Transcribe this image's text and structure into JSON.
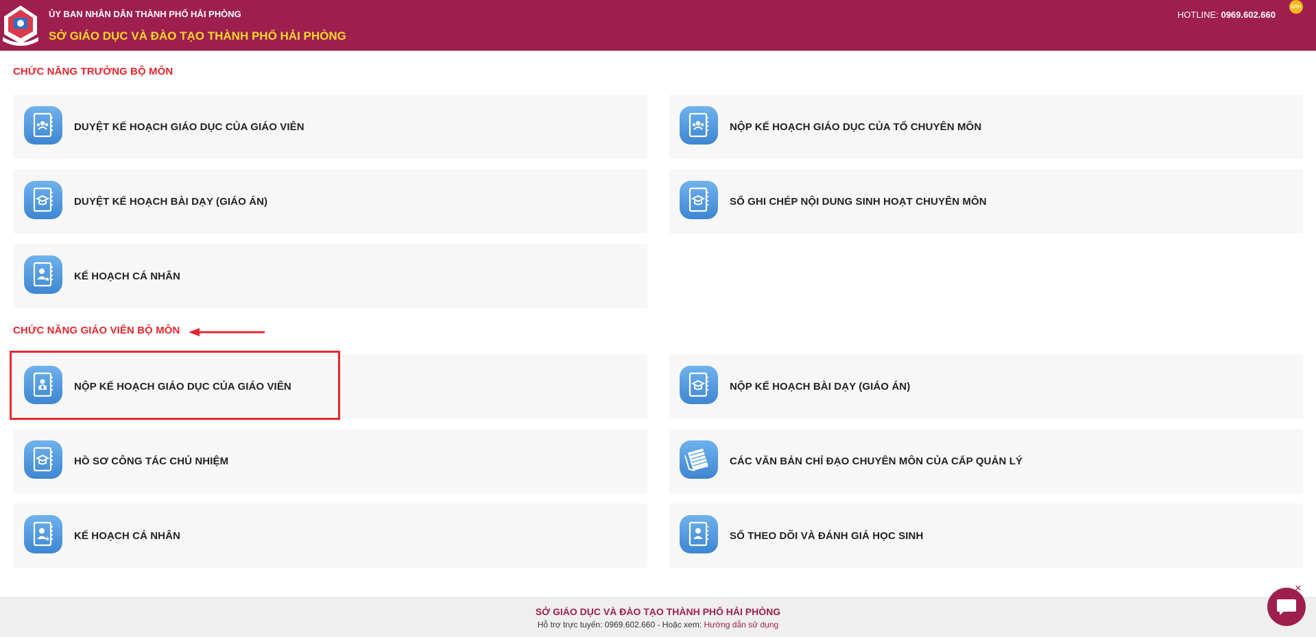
{
  "header": {
    "org_line": "ỦY BAN NHÂN DÂN THÀNH PHỐ HẢI PHÒNG",
    "dept_line": "SỞ GIÁO DỤC VÀ ĐÀO TẠO THÀNH PHỐ HẢI PHÒNG",
    "hotline_label": "HOTLINE:",
    "hotline_number": "0969.602.660",
    "badge": "DTH"
  },
  "section_head": {
    "title": "CHỨC NĂNG TRƯỞNG BỘ MÔN",
    "items": [
      {
        "label": "DUYỆT KẾ HOẠCH GIÁO DỤC CỦA GIÁO VIÊN",
        "icon": "group-icon"
      },
      {
        "label": "NỘP KẾ HOẠCH GIÁO DỤC CỦA TỔ CHUYÊN MÔN",
        "icon": "group-icon"
      },
      {
        "label": "DUYỆT KẾ HOẠCH BÀI DẠY (GIÁO ÁN)",
        "icon": "graduation-cap-icon"
      },
      {
        "label": "SỔ GHI CHÉP NỘI DUNG SINH HOẠT CHUYÊN MÔN",
        "icon": "graduation-cap-icon"
      },
      {
        "label": "KẾ HOẠCH CÁ NHÂN",
        "icon": "person-star-icon"
      }
    ]
  },
  "section_teacher": {
    "title": "CHỨC NĂNG GIÁO VIÊN BỘ MÔN",
    "items": [
      {
        "label": "NỘP KẾ HOẠCH GIÁO DỤC CỦA GIÁO VIÊN",
        "icon": "teacher-icon"
      },
      {
        "label": "NỘP KẾ HOẠCH BÀI DẠY (GIÁO ÁN)",
        "icon": "graduation-cap-icon"
      },
      {
        "label": "HỒ SƠ CÔNG TÁC CHỦ NHIỆM",
        "icon": "graduation-cap-icon"
      },
      {
        "label": "CÁC VĂN BẢN CHỈ ĐẠO CHUYÊN MÔN CỦA CẤP QUẢN LÝ",
        "icon": "documents-icon"
      },
      {
        "label": "KẾ HOẠCH CÁ NHÂN",
        "icon": "person-star-icon"
      },
      {
        "label": "SỔ THEO DÕI VÀ ĐÁNH GIÁ HỌC SINH",
        "icon": "person-icon"
      }
    ]
  },
  "footer": {
    "title": "SỞ GIÁO DỤC VÀ ĐÀO TẠO THÀNH PHỐ HẢI PHÒNG",
    "support_text": "Hỗ trợ trực tuyến: 0969.602.660 - Hoặc xem:",
    "guide_link": "Hướng dẫn sử dụng"
  },
  "colors": {
    "brand": "#9e1f4d",
    "accent_yellow": "#f6d72a",
    "section_red": "#e8252c",
    "icon_blue": "#4a97dc"
  }
}
